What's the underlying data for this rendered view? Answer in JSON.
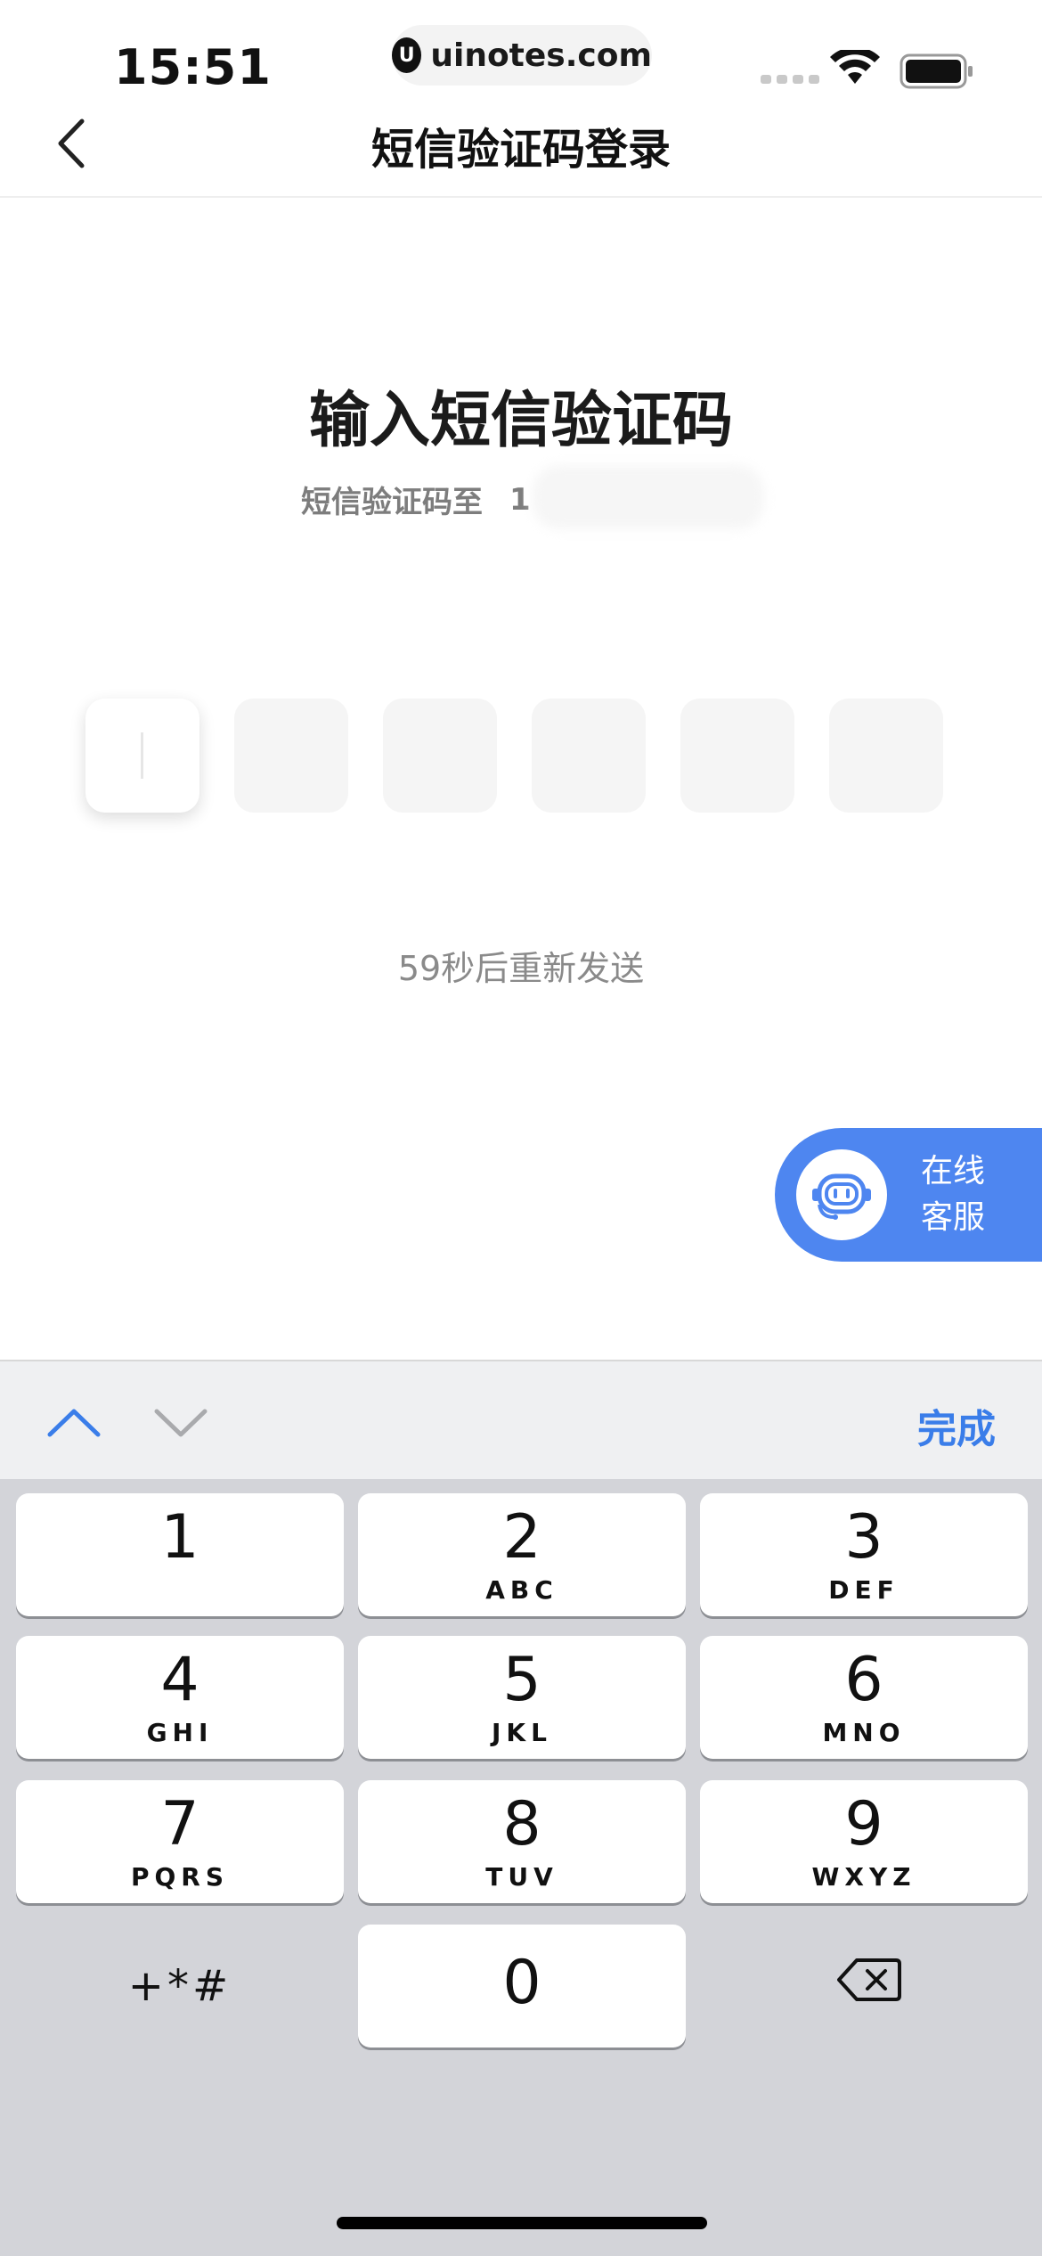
{
  "status_bar": {
    "time": "15:51",
    "watermark": "uinotes.com"
  },
  "nav": {
    "title": "短信验证码登录"
  },
  "main": {
    "heading": "输入短信验证码",
    "subtitle": "短信验证码至",
    "phone_prefix": "1",
    "code_slots": [
      "",
      "",
      "",
      "",
      "",
      ""
    ],
    "resend": "59秒后重新发送"
  },
  "service": {
    "line1": "在线",
    "line2": "客服"
  },
  "keyboard": {
    "done": "完成",
    "keys": [
      {
        "digit": "1",
        "letters": ""
      },
      {
        "digit": "2",
        "letters": "ABC"
      },
      {
        "digit": "3",
        "letters": "DEF"
      },
      {
        "digit": "4",
        "letters": "GHI"
      },
      {
        "digit": "5",
        "letters": "JKL"
      },
      {
        "digit": "6",
        "letters": "MNO"
      },
      {
        "digit": "7",
        "letters": "PQRS"
      },
      {
        "digit": "8",
        "letters": "TUV"
      },
      {
        "digit": "9",
        "letters": "WXYZ"
      },
      {
        "digit": "0",
        "letters": ""
      }
    ],
    "symbols": "+*#"
  },
  "colors": {
    "accent": "#3a7de9",
    "service_bg": "#4e86f0",
    "keyboard_bg": "#d3d4d9"
  }
}
